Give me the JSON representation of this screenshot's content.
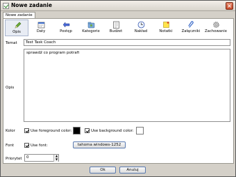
{
  "window": {
    "title": "Nowe zadanie",
    "close_glyph": "×"
  },
  "tabs": [
    {
      "label": "Nowe zadanie"
    }
  ],
  "toolbar": {
    "items": [
      {
        "label": "Opis",
        "icon": "pencil-icon"
      },
      {
        "label": "Daty",
        "icon": "calendar-icon"
      },
      {
        "label": "Postęp",
        "icon": "progress-icon"
      },
      {
        "label": "Kategorie",
        "icon": "categories-icon"
      },
      {
        "label": "Budżet",
        "icon": "budget-icon"
      },
      {
        "label": "Nakład",
        "icon": "clock-icon"
      },
      {
        "label": "Notatki",
        "icon": "notes-icon"
      },
      {
        "label": "Załączniki",
        "icon": "paperclip-icon"
      },
      {
        "label": "Zachowanie",
        "icon": "gear-icon"
      }
    ]
  },
  "form": {
    "subject_label": "Temat",
    "subject_value": "Test Task Coach",
    "description_label": "Opis",
    "description_value": "sprawdź co program potrafi",
    "color_label": "Kolor",
    "use_fg_label": "Use foreground color:",
    "use_bg_label": "Use background color:",
    "fg_color": "#000000",
    "bg_color": "#ffffff",
    "font_label": "Font",
    "use_font_label": "Use font:",
    "font_button_label": "tahoma windows-1252",
    "priority_label": "Priorytet",
    "priority_value": "0"
  },
  "buttons": {
    "ok": "Ok",
    "cancel": "Anuluj"
  },
  "colors": {
    "accent": "#5a7ab0",
    "window_bg": "#d4d0c8"
  }
}
